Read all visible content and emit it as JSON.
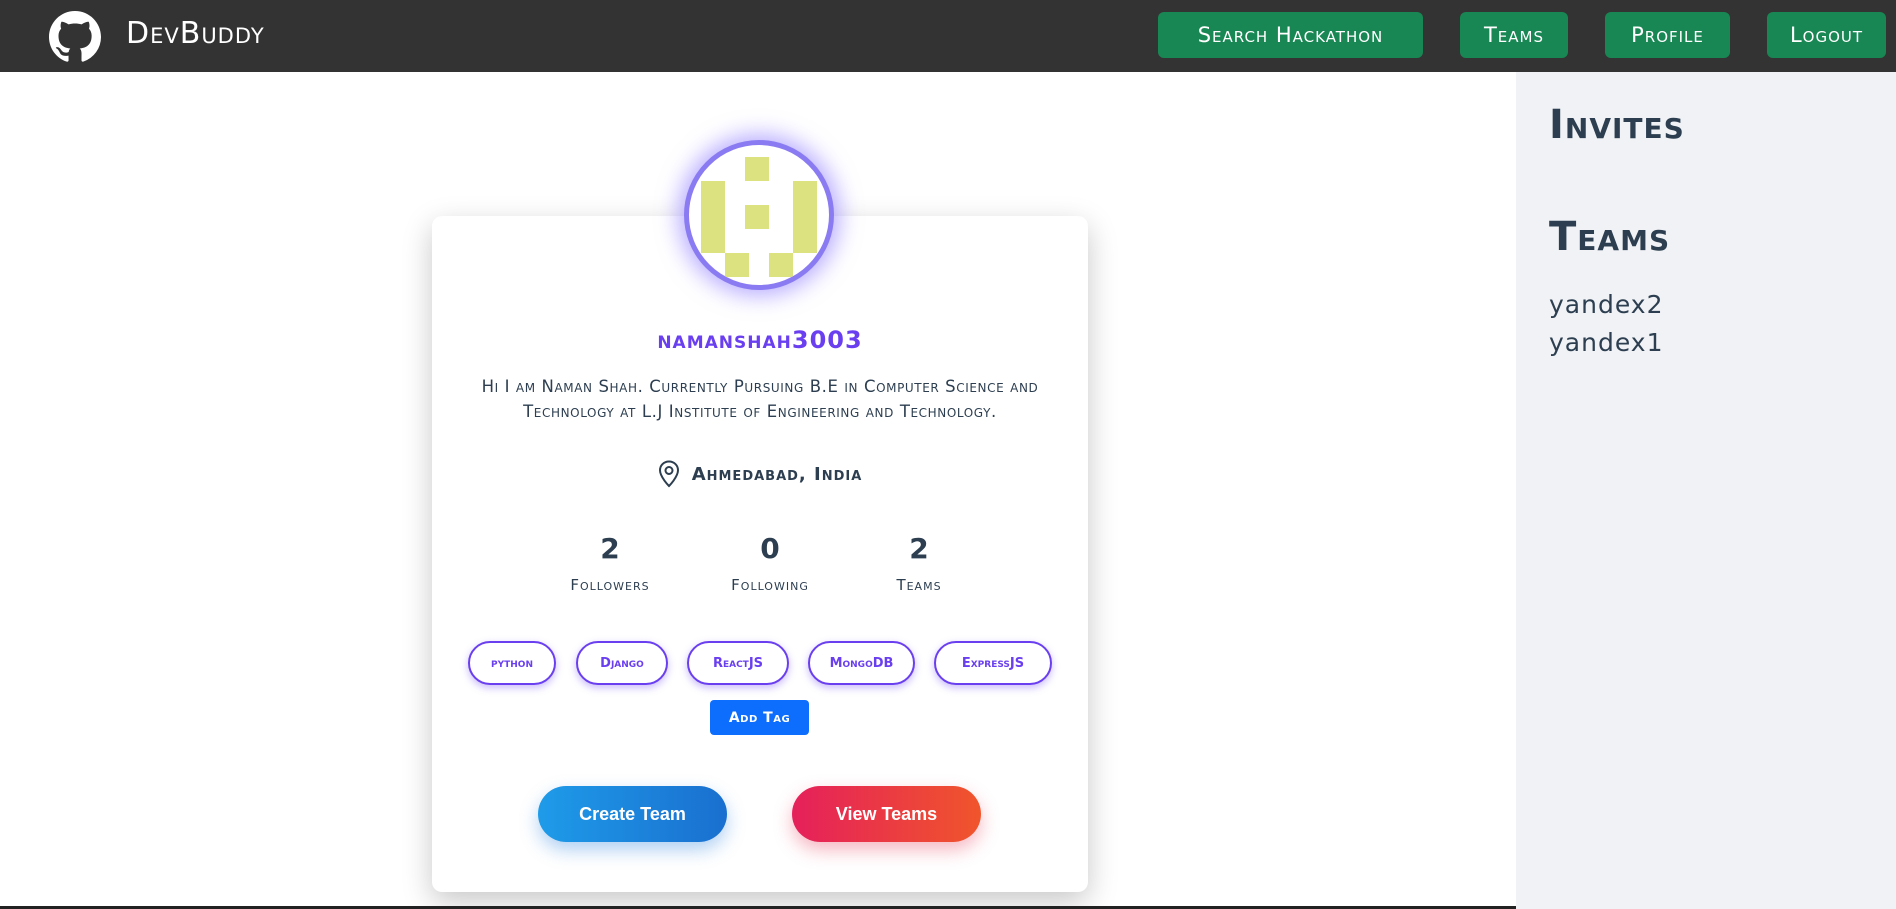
{
  "navbar": {
    "brand": "DevBuddy",
    "items": [
      {
        "label": "Search Hackathon"
      },
      {
        "label": "Teams"
      },
      {
        "label": "Profile"
      },
      {
        "label": "Logout"
      }
    ],
    "nav_button_color": "#198754",
    "bar_color": "#333333"
  },
  "profile": {
    "username": "namanshah3003",
    "bio": "Hi I am Naman Shah. Currently Pursuing B.E in Computer Science and Technology at L.J Institute of Engineering and Technology.",
    "location": "Ahmedabad, India",
    "stats": [
      {
        "value": "2",
        "label": "Followers"
      },
      {
        "value": "0",
        "label": "Following"
      },
      {
        "value": "2",
        "label": "Teams"
      }
    ],
    "tags": [
      "python",
      "Django",
      "ReactJS",
      "MongoDB",
      "ExpressJS"
    ],
    "add_tag_label": "Add Tag",
    "create_team_label": "Create Team",
    "view_teams_label": "View Teams",
    "accent_color": "#6a3ff0"
  },
  "sidebar": {
    "invites_heading": "Invites",
    "teams_heading": "Teams",
    "teams": [
      "yandex2",
      "yandex1"
    ]
  }
}
